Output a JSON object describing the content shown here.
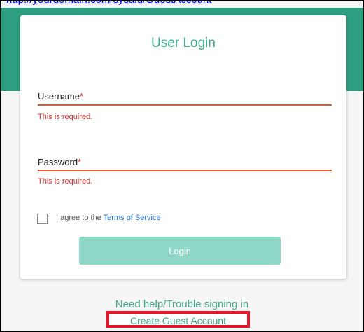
{
  "top_link": {
    "text": "http://yourdomain.com/sysaid/GuestAccount"
  },
  "login_card": {
    "title": "User Login",
    "username": {
      "label": "Username",
      "required_marker": "*",
      "error": "This is required."
    },
    "password": {
      "label": "Password",
      "required_marker": "*",
      "error": "This is required."
    },
    "agree": {
      "prefix": "I agree to the ",
      "terms_link": "Terms of Service",
      "checked": false
    },
    "login_button": "Login"
  },
  "footer": {
    "help_link": "Need help/Trouble signing in",
    "guest_link": "Create Guest Account"
  },
  "colors": {
    "accent": "#2e9e81",
    "title": "#3daa8c",
    "error": "#d32f2f",
    "field_underline": "#e15b2e",
    "button_disabled": "#8fd8c8",
    "link": "#1e6ec8",
    "highlight_box": "#e8152b"
  }
}
